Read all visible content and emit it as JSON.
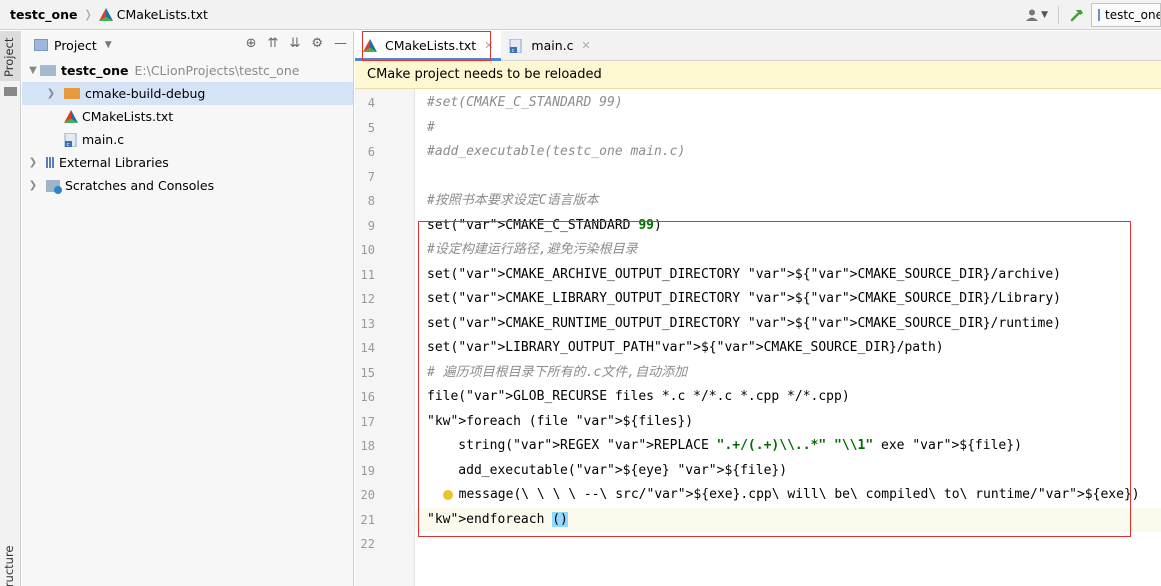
{
  "navbar": {
    "project_name": "testc_one",
    "file_name": "CMakeLists.txt",
    "config_label": "testc_one"
  },
  "tool_stripe": {
    "project_label": "Project",
    "structure_label": "Structure"
  },
  "project_panel": {
    "dropdown_label": "Project",
    "tree": {
      "root_name": "testc_one",
      "root_path": "E:\\CLionProjects\\testc_one",
      "build_folder": "cmake-build-debug",
      "cmake_file": "CMakeLists.txt",
      "main_file": "main.c",
      "external_libraries": "External Libraries",
      "scratches": "Scratches and Consoles"
    }
  },
  "editor": {
    "tabs": [
      {
        "label": "CMakeLists.txt"
      },
      {
        "label": "main.c"
      }
    ],
    "notification": "CMake project needs to be reloaded",
    "lines": [
      {
        "num": "4",
        "text": "#set(CMAKE_C_STANDARD 99)"
      },
      {
        "num": "5",
        "text": "#"
      },
      {
        "num": "6",
        "text": "#add_executable(testc_one main.c)"
      },
      {
        "num": "7",
        "text": ""
      },
      {
        "num": "8",
        "text": "#按照书本要求设定C语言版本"
      },
      {
        "num": "9",
        "text": "set(CMAKE_C_STANDARD 99)"
      },
      {
        "num": "10",
        "text": "#设定构建运行路径,避免污染根目录"
      },
      {
        "num": "11",
        "text": "set(CMAKE_ARCHIVE_OUTPUT_DIRECTORY ${CMAKE_SOURCE_DIR}/archive)"
      },
      {
        "num": "12",
        "text": "set(CMAKE_LIBRARY_OUTPUT_DIRECTORY ${CMAKE_SOURCE_DIR}/Library)"
      },
      {
        "num": "13",
        "text": "set(CMAKE_RUNTIME_OUTPUT_DIRECTORY ${CMAKE_SOURCE_DIR}/runtime)"
      },
      {
        "num": "14",
        "text": "set(LIBRARY_OUTPUT_PATH${CMAKE_SOURCE_DIR}/path)"
      },
      {
        "num": "15",
        "text": "# 遍历项目根目录下所有的.c文件,自动添加"
      },
      {
        "num": "16",
        "text": "file(GLOB_RECURSE files *.c */*.c *.cpp */*.cpp)"
      },
      {
        "num": "17",
        "text": "foreach (file ${files})"
      },
      {
        "num": "18",
        "text": "    string(REGEX REPLACE \".+/(.+)\\\\..*\" \"\\\\1\" exe ${file})"
      },
      {
        "num": "19",
        "text": "    add_executable(${eye} ${file})"
      },
      {
        "num": "20",
        "text": "    message(\\ \\ \\ \\ --\\ src/${exe}.cpp\\ will\\ be\\ compiled\\ to\\ runtime/${exe})"
      },
      {
        "num": "21",
        "text": "endforeach ()"
      },
      {
        "num": "22",
        "text": ""
      }
    ]
  },
  "colors": {
    "annotation_red": "#e03030",
    "notification_bg": "#fdf7d2",
    "keyword_navy": "#000080",
    "variable_green": "#1a6b1a",
    "tab_underline": "#4a88d7"
  }
}
